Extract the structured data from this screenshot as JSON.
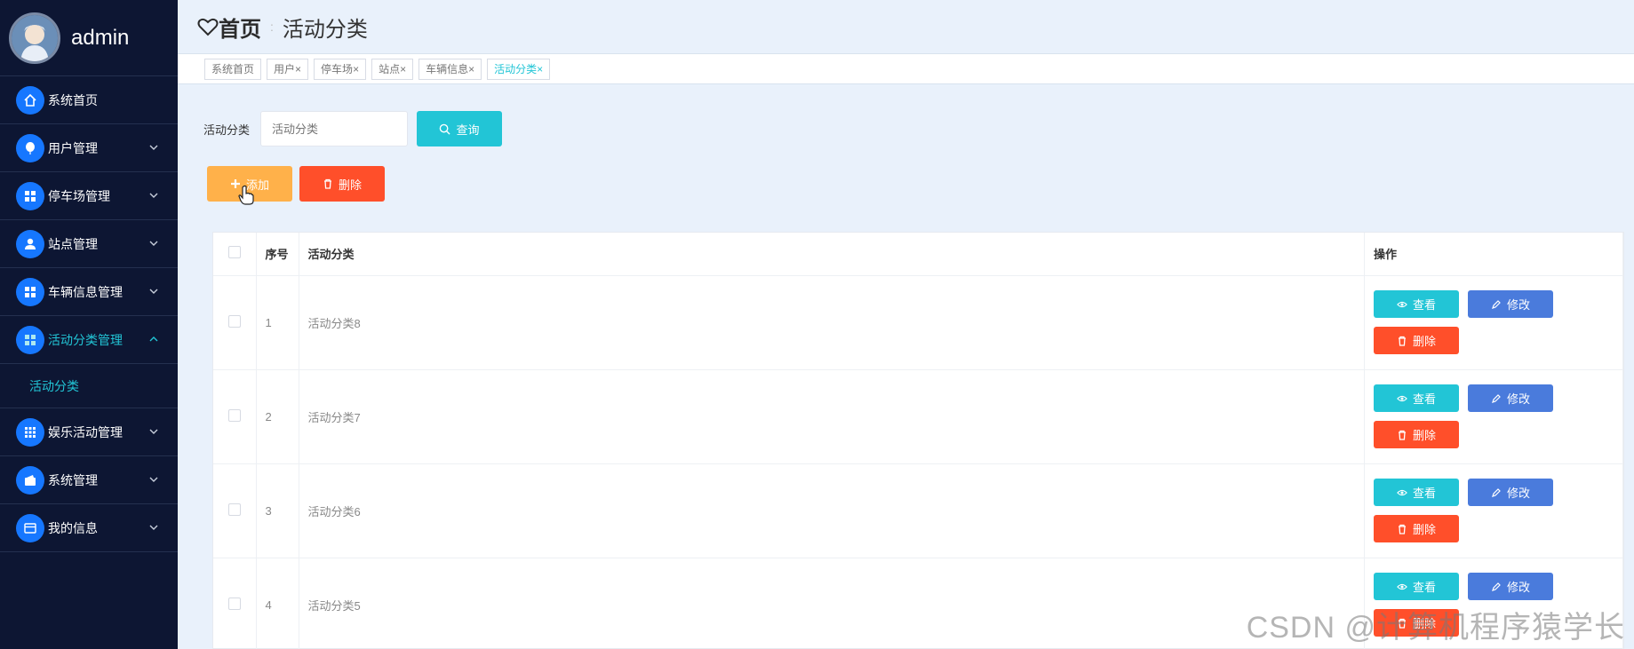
{
  "brand": {
    "name": "admin"
  },
  "sidebar": {
    "items": [
      {
        "label": "系统首页",
        "icon": "home-icon",
        "has_arrow": false
      },
      {
        "label": "用户管理",
        "icon": "balloon-icon",
        "has_arrow": true
      },
      {
        "label": "停车场管理",
        "icon": "grid-icon",
        "has_arrow": true
      },
      {
        "label": "站点管理",
        "icon": "user-icon",
        "has_arrow": true
      },
      {
        "label": "车辆信息管理",
        "icon": "grid-icon",
        "has_arrow": true
      },
      {
        "label": "活动分类管理",
        "icon": "grid-icon",
        "has_arrow": true,
        "expanded": true
      },
      {
        "label": "娱乐活动管理",
        "icon": "apps-icon",
        "has_arrow": true
      },
      {
        "label": "系统管理",
        "icon": "wallet-icon",
        "has_arrow": true
      },
      {
        "label": "我的信息",
        "icon": "card-icon",
        "has_arrow": true
      }
    ],
    "submenu": {
      "label": "活动分类"
    }
  },
  "header": {
    "home": "首页",
    "separator": ":",
    "current": "活动分类"
  },
  "tags": [
    {
      "label": "系统首页",
      "close": ""
    },
    {
      "label": "用户",
      "close": "×"
    },
    {
      "label": "停车场",
      "close": "×"
    },
    {
      "label": "站点",
      "close": "×"
    },
    {
      "label": "车辆信息",
      "close": "×"
    },
    {
      "label": "活动分类",
      "close": "×",
      "active": true
    }
  ],
  "search": {
    "label": "活动分类",
    "placeholder": "活动分类",
    "query_label": "查询"
  },
  "actions": {
    "add_label": "添加",
    "delete_label": "删除"
  },
  "table": {
    "headers": {
      "index": "序号",
      "category": "活动分类",
      "ops": "操作"
    },
    "rows": [
      {
        "index": "1",
        "category": "活动分类8"
      },
      {
        "index": "2",
        "category": "活动分类7"
      },
      {
        "index": "3",
        "category": "活动分类6"
      },
      {
        "index": "4",
        "category": "活动分类5"
      }
    ],
    "row_actions": {
      "view": "查看",
      "edit": "修改",
      "delete": "删除"
    }
  },
  "watermark": "CSDN @计算机程序猿学长",
  "colors": {
    "accent": "#22c5d6",
    "sidebar_bg": "#0d1633",
    "add": "#ffb14a",
    "danger": "#ff4f2a",
    "edit": "#4a7bdc"
  }
}
